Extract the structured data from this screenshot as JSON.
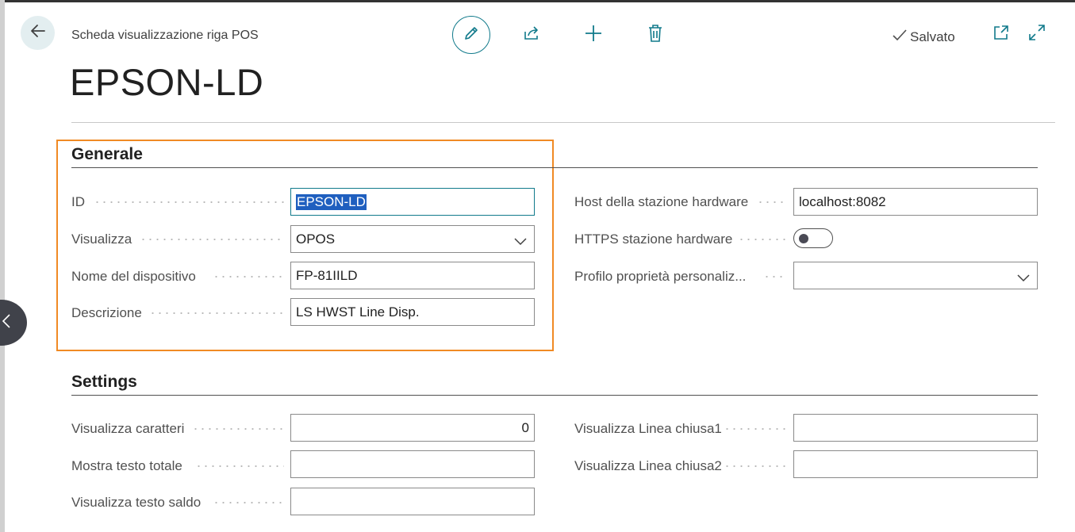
{
  "header": {
    "breadcrumb": "Scheda visualizzazione riga POS",
    "title": "EPSON-LD",
    "saved_label": "Salvato"
  },
  "icons": {
    "back": "arrow-left-icon",
    "edit": "pencil-icon",
    "share": "share-icon",
    "new": "plus-icon",
    "delete": "trash-icon",
    "saved": "check-icon",
    "open_new_window": "open-new-window-icon",
    "expand": "expand-icon",
    "side_collapse": "chevron-left-icon",
    "dropdown": "chevron-down-icon"
  },
  "colors": {
    "accent": "#117a8b",
    "highlight_border": "#f08a24",
    "selection": "#1f5fbf"
  },
  "sections": {
    "generale": {
      "title": "Generale",
      "fields": {
        "id": {
          "label": "ID",
          "value": "EPSON-LD"
        },
        "visualizza": {
          "label": "Visualizza",
          "value": "OPOS"
        },
        "nome_dispositivo": {
          "label": "Nome del dispositivo",
          "value": "FP-81IILD"
        },
        "descrizione": {
          "label": "Descrizione",
          "value": "LS HWST Line Disp."
        },
        "host": {
          "label": "Host della stazione hardware",
          "value": "localhost:8082"
        },
        "https": {
          "label": "HTTPS stazione hardware",
          "value": false
        },
        "profilo": {
          "label": "Profilo proprietà personaliz...",
          "value": ""
        }
      }
    },
    "settings": {
      "title": "Settings",
      "fields": {
        "visualizza_caratteri": {
          "label": "Visualizza caratteri",
          "value": "0"
        },
        "mostra_testo_totale": {
          "label": "Mostra testo totale",
          "value": ""
        },
        "visualizza_testo_saldo": {
          "label": "Visualizza testo saldo",
          "value": ""
        },
        "linea_chiusa1": {
          "label": "Visualizza Linea chiusa1",
          "value": ""
        },
        "linea_chiusa2": {
          "label": "Visualizza Linea chiusa2",
          "value": ""
        }
      }
    }
  }
}
